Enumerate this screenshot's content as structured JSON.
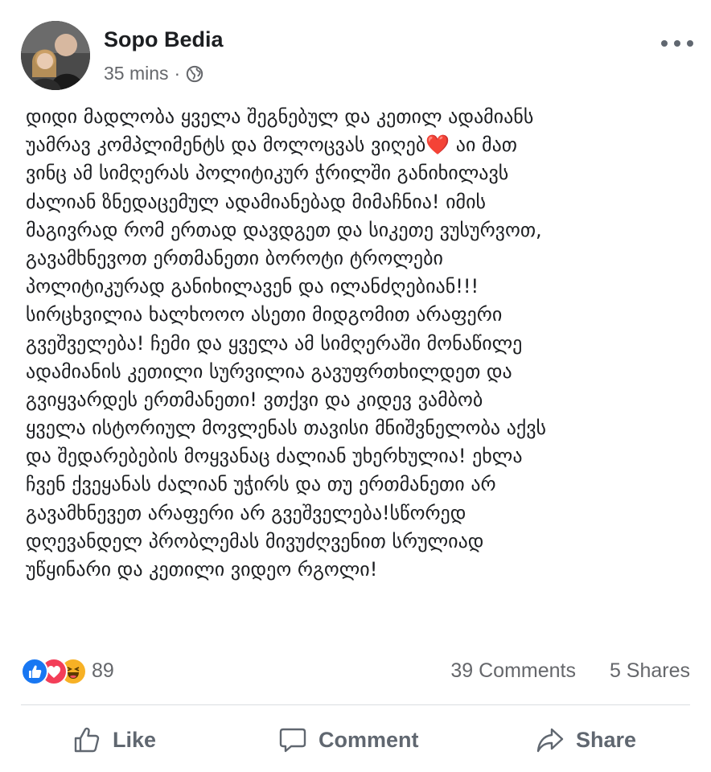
{
  "post": {
    "author": "Sopo Bedia",
    "timestamp": "35 mins",
    "separator": "·",
    "privacy_icon": "globe-icon",
    "more_icon": "more-options-icon",
    "text_lines": [
      "დიდი მადლობა ყველა შეგნებულ და კეთილ ადამიანს",
      "უამრავ კომპლიმენტს და მოლოცვას ვიღებ❤️ აი მათ",
      "ვინც ამ სიმღერას პოლიტიკურ ჭრილში განიხილავს",
      "ძალიან ზნედაცემულ ადამიანებად მიმაჩნია! იმის",
      "მაგივრად რომ ერთად დავდგეთ და სიკეთე ვუსურვოთ,",
      "გავამხნევოთ ერთმანეთი ბოროტი ტროლები",
      "პოლიტიკურად განიხილავენ და ილანძღებიან!!!",
      "სირცხვილია ხალხოოო ასეთი მიდგომით არაფერი",
      "გვეშველება! ჩემი და ყველა ამ სიმღერაში მონაწილე",
      "ადამიანის კეთილი სურვილია გავუფრთხილდეთ და",
      "გვიყვარდეს ერთმანეთი! ვთქვი და კიდევ ვამბობ",
      "ყველა ისტორიულ მოვლენას თავისი მნიშვნელობა აქვს",
      "და შედარებების მოყვანაც ძალიან უხერხულია! ეხლა",
      "ჩვენ ქვეყანას ძალიან უჭირს და თუ ერთმანეთი არ",
      "გავამხნევეთ არაფერი არ გვეშველება!სწორედ",
      "დღევანდელ პრობლემას მივუძღვენით სრულიად",
      "უწყინარი და კეთილი ვიდეო რგოლი!"
    ]
  },
  "stats": {
    "reaction_icons": [
      "like-reaction-icon",
      "love-reaction-icon",
      "haha-reaction-icon"
    ],
    "reaction_count": "89",
    "comments": "39 Comments",
    "shares": "5 Shares"
  },
  "actions": {
    "like": "Like",
    "comment": "Comment",
    "share": "Share"
  },
  "colors": {
    "text": "#1c1e21",
    "secondary": "#65676b",
    "like_blue": "#1877f2",
    "love_red": "#f33e58",
    "haha_yellow": "#f7b125",
    "divider": "#dadde1"
  }
}
